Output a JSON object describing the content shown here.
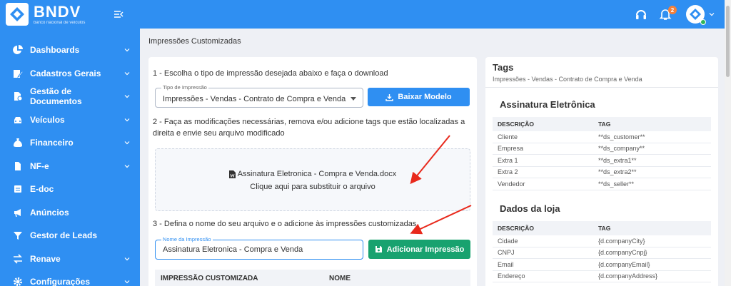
{
  "brand": {
    "name": "BNDV",
    "subtitle": "banco nacional de veículos"
  },
  "sidebar": {
    "items": [
      {
        "label": "Dashboards",
        "icon": "pie-chart-icon",
        "expandable": true
      },
      {
        "label": "Cadastros Gerais",
        "icon": "edit-icon",
        "expandable": true
      },
      {
        "label": "Gestão de Documentos",
        "icon": "documents-icon",
        "expandable": true
      },
      {
        "label": "Veículos",
        "icon": "car-icon",
        "expandable": true
      },
      {
        "label": "Financeiro",
        "icon": "money-bag-icon",
        "expandable": true
      },
      {
        "label": "NF-e",
        "icon": "file-icon",
        "expandable": true
      },
      {
        "label": "E-doc",
        "icon": "doc-icon",
        "expandable": false
      },
      {
        "label": "Anúncios",
        "icon": "megaphone-icon",
        "expandable": false
      },
      {
        "label": "Gestor de Leads",
        "icon": "funnel-icon",
        "expandable": false
      },
      {
        "label": "Renave",
        "icon": "exchange-icon",
        "expandable": true
      },
      {
        "label": "Configurações",
        "icon": "gear-icon",
        "expandable": true
      }
    ]
  },
  "topbar": {
    "notifications_count": "2"
  },
  "page": {
    "title": "Impressões Customizadas"
  },
  "main": {
    "step1": "1 - Escolha o tipo de impressão desejada abaixo e faça o download",
    "type_select": {
      "legend": "Tipo de Impressão",
      "value": "Impressões - Vendas - Contrato de Compra e Venda"
    },
    "download_label": "Baixar Modelo",
    "step2_line1": "2 - Faça as modificações necessárias, remova e/ou adicione tags que estão localizadas a",
    "step2_line2": "direita e envie seu arquivo modificado",
    "dropzone": {
      "file": "Assinatura Eletronica - Compra e Venda.docx",
      "hint": "Clique aqui para substituir o arquivo"
    },
    "step3": "3 - Defina o nome do seu arquivo e o adicione às impressões customizadas",
    "name_field": {
      "legend": "Nome da Impressão",
      "value": "Assinatura Eletronica - Compra e Venda"
    },
    "add_label": "Adicionar Impressão",
    "table": {
      "col1": "IMPRESSÃO CUSTOMIZADA",
      "col2": "NOME"
    }
  },
  "tags": {
    "title": "Tags",
    "subtitle": "Impressões - Vendas - Contrato de Compra e Venda",
    "sections": [
      {
        "title": "Assinatura Eletrônica",
        "headers": [
          "DESCRIÇÃO",
          "TAG"
        ],
        "rows": [
          [
            "Cliente",
            "**ds_customer**"
          ],
          [
            "Empresa",
            "**ds_company**"
          ],
          [
            "Extra 1",
            "**ds_extra1**"
          ],
          [
            "Extra 2",
            "**ds_extra2**"
          ],
          [
            "Vendedor",
            "**ds_seller**"
          ]
        ]
      },
      {
        "title": "Dados da loja",
        "headers": [
          "DESCRIÇÃO",
          "TAG"
        ],
        "rows": [
          [
            "Cidade",
            "{d.companyCity}"
          ],
          [
            "CNPJ",
            "{d.companyCnpj}"
          ],
          [
            "Email",
            "{d.companyEmail}"
          ],
          [
            "Endereço",
            "{d.companyAddress}"
          ]
        ]
      }
    ]
  },
  "colors": {
    "primary": "#2f8ff2",
    "success": "#18a26f",
    "badge": "#f5813a",
    "arrow": "#e8291c"
  }
}
